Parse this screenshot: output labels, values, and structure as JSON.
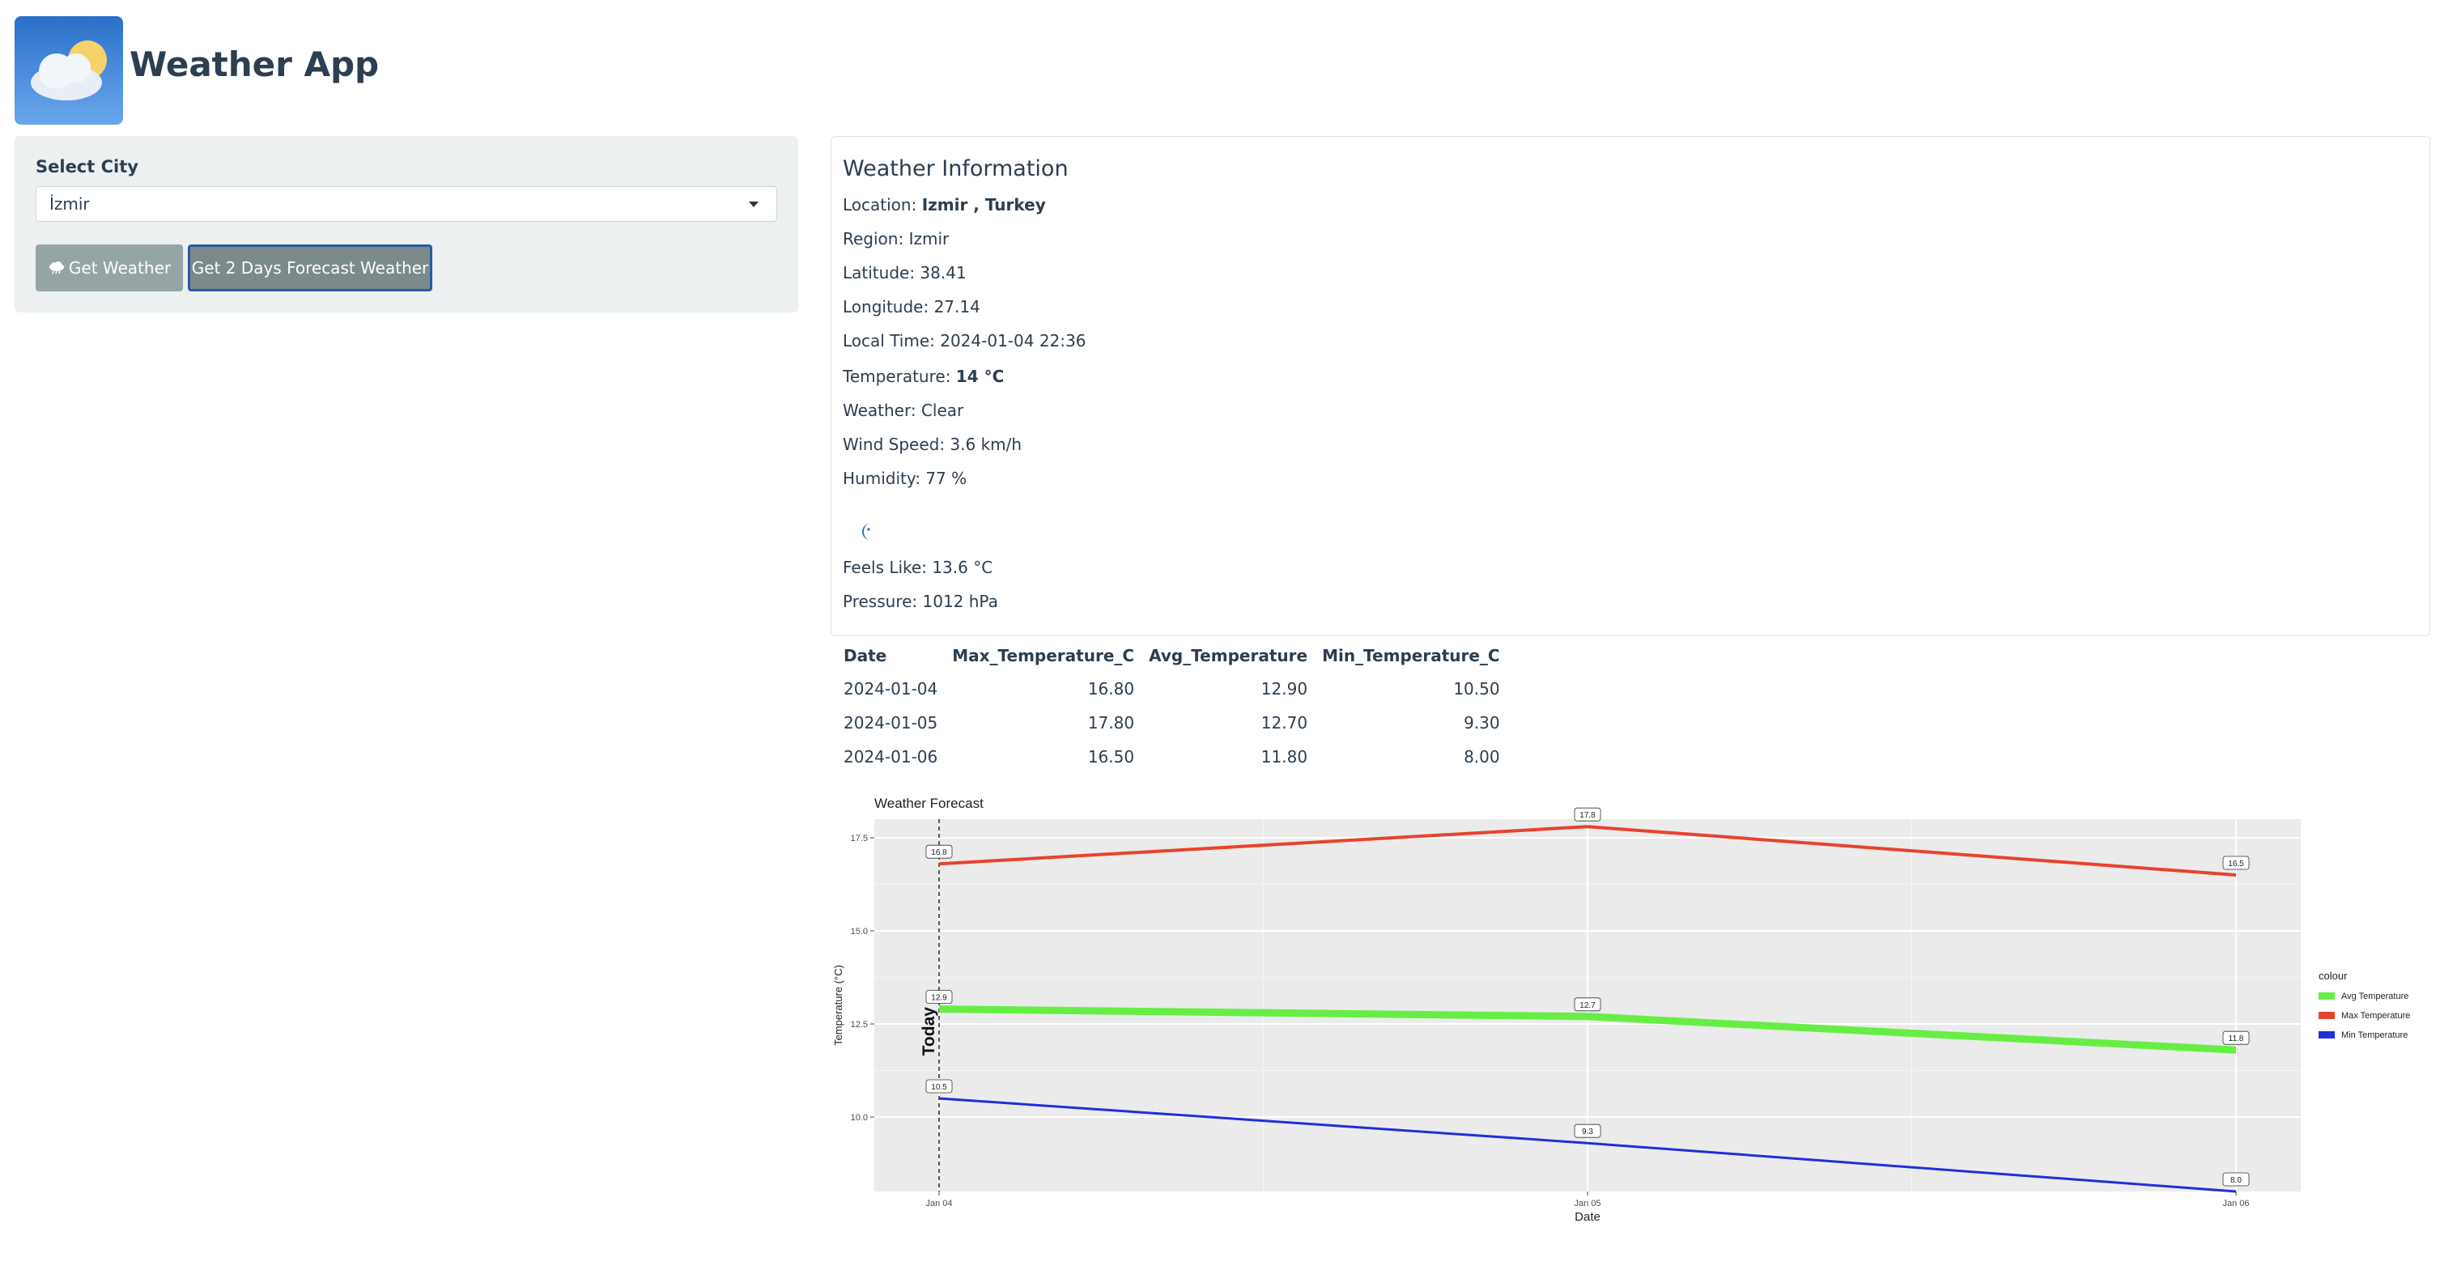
{
  "app": {
    "title": "Weather App",
    "logo_icon": "cloud-sun-icon"
  },
  "sidebar": {
    "city_label": "Select City",
    "city_value": "İzmir",
    "get_weather_label": "Get Weather",
    "get_weather_icon": "cloud-rain-icon",
    "forecast_label": "Get 2 Days Forecast Weather"
  },
  "weather": {
    "title": "Weather Information",
    "location_label": "Location: ",
    "location_value": "Izmir , Turkey",
    "region": "Region: Izmir",
    "latitude": "Latitude: 38.41",
    "longitude": "Longitude: 27.14",
    "local_time": "Local Time: 2024-01-04 22:36",
    "temperature_label": "Temperature: ",
    "temperature_value": "14 °C",
    "condition": "Weather: Clear",
    "wind_speed": "Wind Speed: 3.6 km/h",
    "humidity": "Humidity: 77 %",
    "condition_icon": "moon-icon",
    "feels_like": "Feels Like: 13.6 °C",
    "pressure": "Pressure: 1012 hPa"
  },
  "forecast_table": {
    "headers": [
      "Date",
      "Max_Temperature_C",
      "Avg_Temperature",
      "Min_Temperature_C"
    ],
    "rows": [
      [
        "2024-01-04",
        "16.80",
        "12.90",
        "10.50"
      ],
      [
        "2024-01-05",
        "17.80",
        "12.70",
        "9.30"
      ],
      [
        "2024-01-06",
        "16.50",
        "11.80",
        "8.00"
      ]
    ]
  },
  "chart_data": {
    "type": "line",
    "title": "Weather Forecast",
    "xlabel": "Date",
    "ylabel": "Temperature (°C)",
    "x": [
      "Jan 04",
      "Jan 05",
      "Jan 06"
    ],
    "ylim": [
      8,
      18
    ],
    "yticks": [
      10.0,
      12.5,
      15.0,
      17.5
    ],
    "ytick_labels": [
      "10.0",
      "12.5",
      "15.0",
      "17.5"
    ],
    "grid": true,
    "legend_title": "colour",
    "legend_position": "right",
    "today_annotation": "Today",
    "series": [
      {
        "name": "Avg Temperature",
        "color": "#66ee44",
        "values": [
          12.9,
          12.7,
          11.8
        ],
        "labels": [
          "12.9",
          "12.7",
          "11.8"
        ]
      },
      {
        "name": "Max Temperature",
        "color": "#e8432e",
        "values": [
          16.8,
          17.8,
          16.5
        ],
        "labels": [
          "16.8",
          "17.8",
          "16.5"
        ]
      },
      {
        "name": "Min Temperature",
        "color": "#1f2fdc",
        "values": [
          10.5,
          9.3,
          8.0
        ],
        "labels": [
          "10.5",
          "9.3",
          "8.0"
        ]
      }
    ]
  }
}
